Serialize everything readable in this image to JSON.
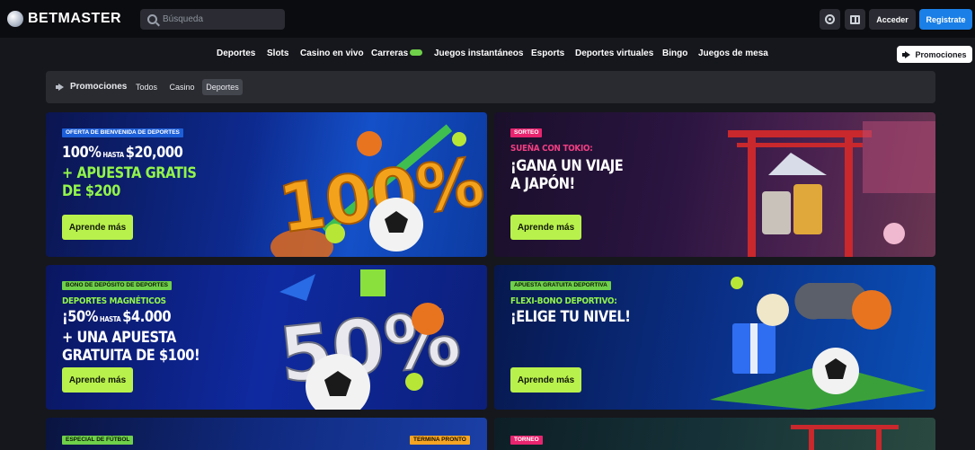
{
  "header": {
    "logo_text": "BETMASTER",
    "search_placeholder": "Búsqueda",
    "login_label": "Acceder",
    "register_label": "Registrate"
  },
  "nav": {
    "items": [
      "Deportes",
      "Slots",
      "Casino en vivo",
      "Carreras",
      "Juegos instantáneos",
      "Esports",
      "Deportes virtuales",
      "Bingo",
      "Juegos de mesa"
    ],
    "promo_button": "Promociones"
  },
  "filters": {
    "title": "Promociones",
    "chips": [
      "Todos",
      "Casino",
      "Deportes"
    ],
    "active": "Deportes"
  },
  "cards": [
    {
      "tag": "Oferta de bienvenida de deportes",
      "lines": [
        [
          "100%",
          " HASTA ",
          "$20,000"
        ],
        [
          "+ APUESTA GRATIS"
        ],
        [
          "DE $200"
        ]
      ],
      "art_text": "100%",
      "cta": "Aprende más"
    },
    {
      "tag": "Sorteo",
      "subline": "SUEÑA CON TOKIO:",
      "lines": [
        [
          "¡GANA UN VIAJE"
        ],
        [
          "A JAPÓN!"
        ]
      ],
      "cta": "Aprende más"
    },
    {
      "tag": "Bono de depósito de deportes",
      "subline": "DEPORTES MAGNÉTICOS",
      "lines": [
        [
          "¡50%",
          " HASTA ",
          "$4.000"
        ],
        [
          "+ UNA APUESTA"
        ],
        [
          "GRATUITA DE $100!"
        ]
      ],
      "art_text": "50%",
      "cta": "Aprende más"
    },
    {
      "tag": "Apuesta gratuita deportiva",
      "subline": "FLEXI-BONO DEPORTIVO:",
      "lines": [
        [
          "¡ELIGE TU NIVEL!"
        ]
      ],
      "cta": "Aprende más"
    },
    {
      "tag": "Especial de fútbol",
      "badge": "Termina pronto"
    },
    {
      "tag": "Torneo"
    }
  ],
  "colors": {
    "accent_green": "#b9f14c",
    "register_blue": "#1a7fe6",
    "tag_pink": "#e8246f",
    "tag_blue": "#1d5fd8",
    "tag_green": "#6fd04a"
  }
}
